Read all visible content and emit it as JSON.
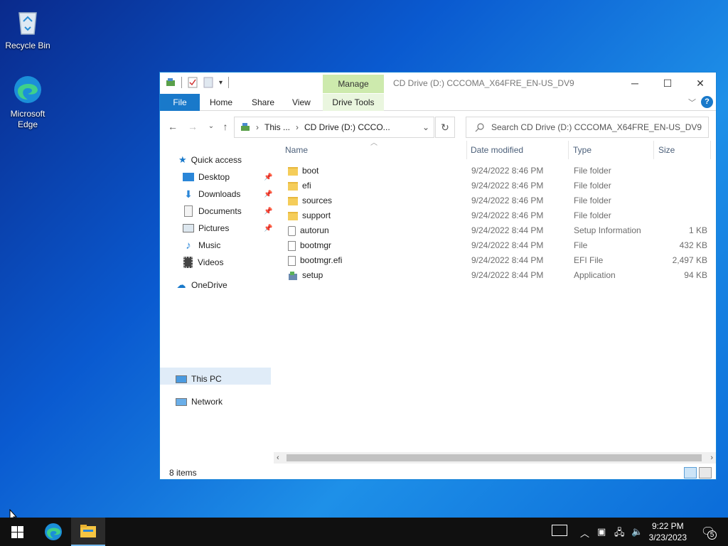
{
  "desktop": {
    "icons": [
      {
        "label": "Recycle Bin",
        "icon": "recycle-bin-icon"
      },
      {
        "label": "Microsoft Edge",
        "icon": "edge-icon"
      }
    ]
  },
  "window": {
    "title": "CD Drive (D:) CCCOMA_X64FRE_EN-US_DV9",
    "manage_label": "Manage",
    "drive_tools_label": "Drive Tools",
    "tabs": [
      "File",
      "Home",
      "Share",
      "View"
    ],
    "help_label": "?",
    "address": {
      "crumb1": "This ...",
      "crumb2": "CD Drive (D:) CCCO..."
    },
    "search_placeholder": "Search CD Drive (D:) CCCOMA_X64FRE_EN-US_DV9",
    "sidebar": {
      "quick_access": "Quick access",
      "items": [
        "Desktop",
        "Downloads",
        "Documents",
        "Pictures",
        "Music",
        "Videos"
      ],
      "onedrive": "OneDrive",
      "this_pc": "This PC",
      "network": "Network"
    },
    "columns": {
      "name": "Name",
      "date": "Date modified",
      "type": "Type",
      "size": "Size"
    },
    "files": [
      {
        "name": "boot",
        "date": "9/24/2022 8:46 PM",
        "type": "File folder",
        "size": "",
        "kind": "folder"
      },
      {
        "name": "efi",
        "date": "9/24/2022 8:46 PM",
        "type": "File folder",
        "size": "",
        "kind": "folder"
      },
      {
        "name": "sources",
        "date": "9/24/2022 8:46 PM",
        "type": "File folder",
        "size": "",
        "kind": "folder"
      },
      {
        "name": "support",
        "date": "9/24/2022 8:46 PM",
        "type": "File folder",
        "size": "",
        "kind": "folder"
      },
      {
        "name": "autorun",
        "date": "9/24/2022 8:44 PM",
        "type": "Setup Information",
        "size": "1 KB",
        "kind": "settings"
      },
      {
        "name": "bootmgr",
        "date": "9/24/2022 8:44 PM",
        "type": "File",
        "size": "432 KB",
        "kind": "file"
      },
      {
        "name": "bootmgr.efi",
        "date": "9/24/2022 8:44 PM",
        "type": "EFI File",
        "size": "2,497 KB",
        "kind": "file"
      },
      {
        "name": "setup",
        "date": "9/24/2022 8:44 PM",
        "type": "Application",
        "size": "94 KB",
        "kind": "app"
      }
    ],
    "status": "8 items"
  },
  "taskbar": {
    "time": "9:22 PM",
    "date": "3/23/2023",
    "notification_count": "5"
  },
  "colors": {
    "accent": "#1979ca",
    "manage_bg": "#cdeaad",
    "taskbar": "#101010"
  }
}
